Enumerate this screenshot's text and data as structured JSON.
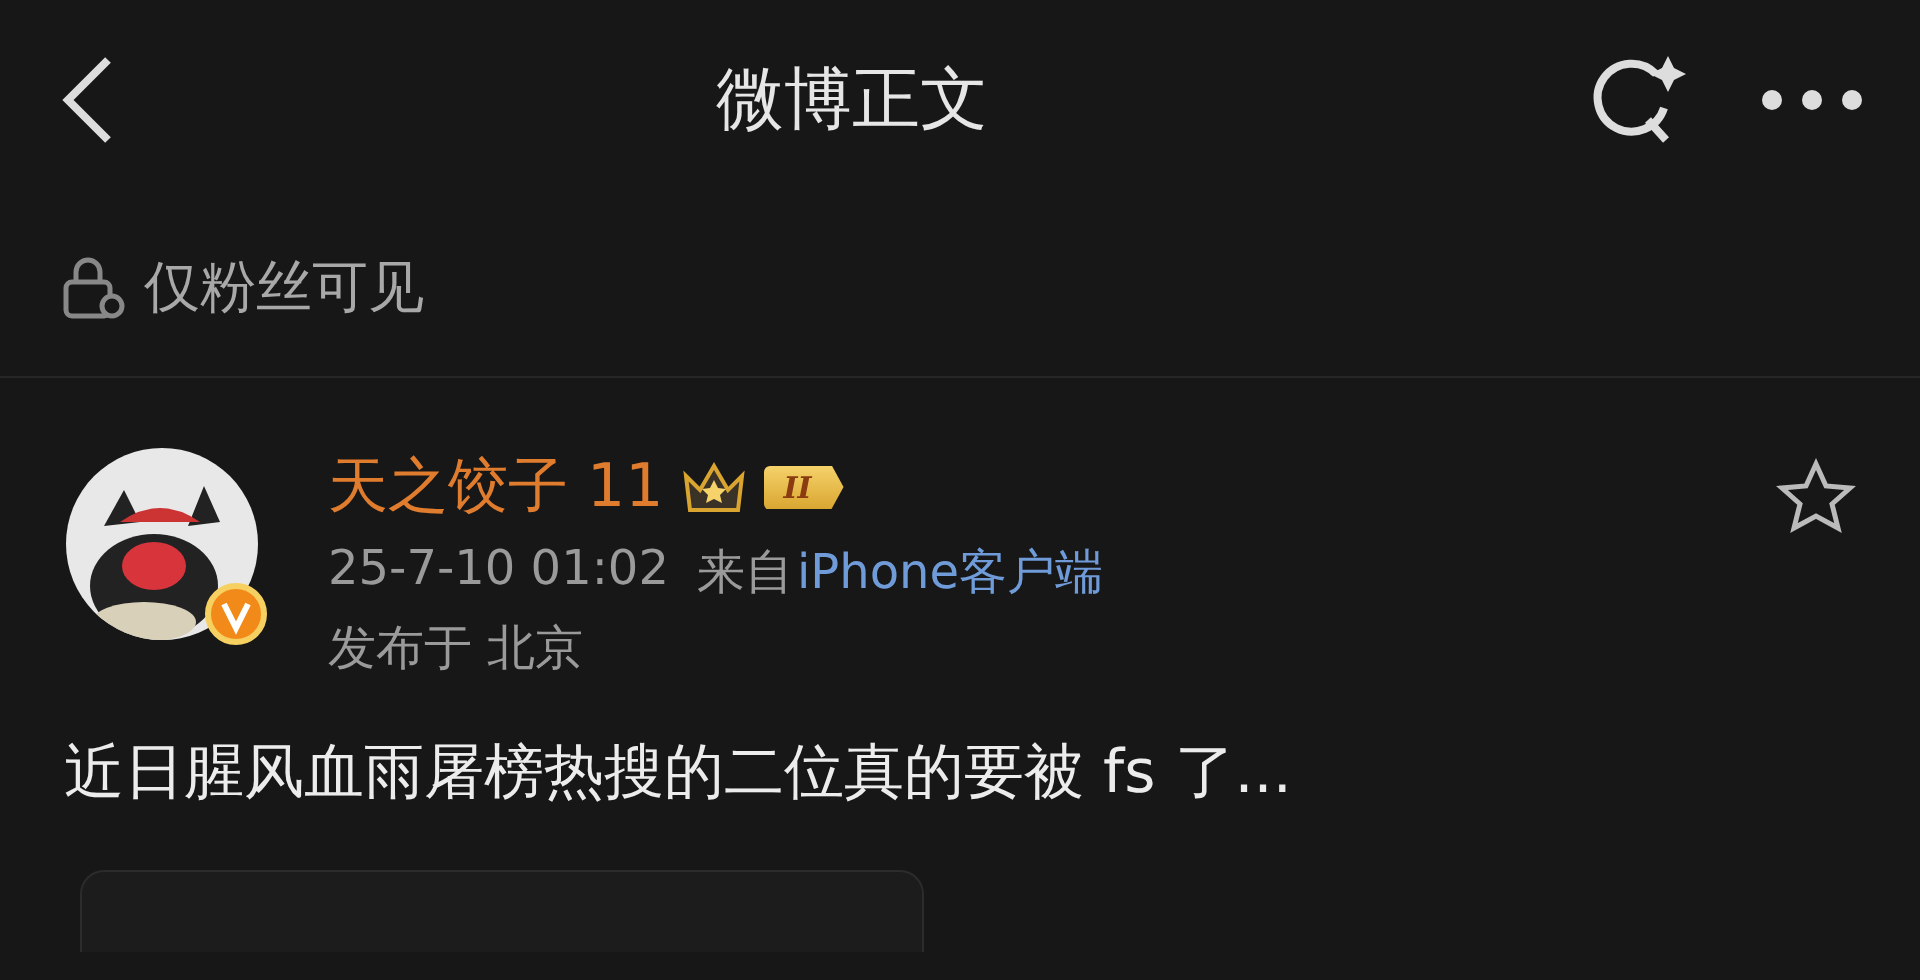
{
  "header": {
    "title": "微博正文"
  },
  "visibility": {
    "label": "仅粉丝可见"
  },
  "post": {
    "author": "天之饺子 11",
    "level_badge": "II",
    "verified": true,
    "starred": false,
    "time": "25-7-10 01:02",
    "source_prefix": "来自",
    "source": "iPhone客户端",
    "location": "发布于 北京",
    "text": "近日腥风血雨屠榜热搜的二位真的要被 fs 了..."
  }
}
